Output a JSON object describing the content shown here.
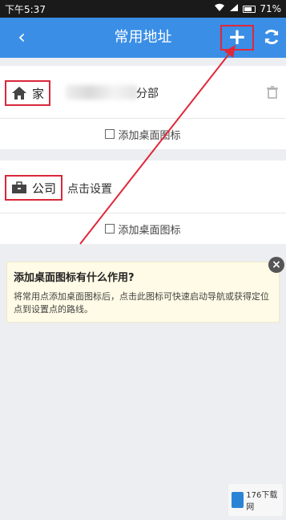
{
  "status_bar": {
    "time": "下午5:37",
    "battery": "71%"
  },
  "header": {
    "title": "常用地址",
    "back_icon": "chevron-left-icon",
    "add_icon": "plus-icon",
    "refresh_icon": "refresh-icon",
    "accent": "#3a8ee6"
  },
  "addresses": [
    {
      "name": "家",
      "icon": "home-icon",
      "address_suffix": "分部",
      "shortcut_label": "添加桌面图标"
    },
    {
      "name": "公司",
      "icon": "briefcase-icon",
      "address": "点击设置",
      "shortcut_label": "添加桌面图标"
    }
  ],
  "tip": {
    "question": "添加桌面图标有什么作用?",
    "answer": "将常用点添加桌面图标后，点击此图标可快速启动导航或获得定位点到设置点的路线。"
  },
  "watermark": {
    "text": "176下载网"
  },
  "annotation_color": "#e0283a"
}
